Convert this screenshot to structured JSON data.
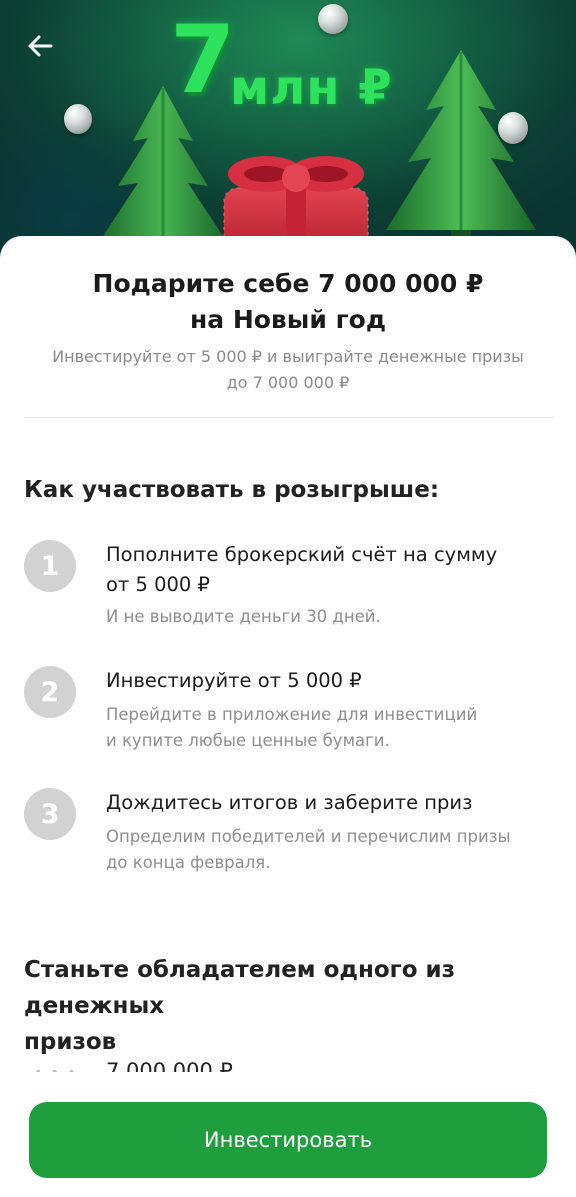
{
  "hero": {
    "title_number": "7",
    "title_suffix": "млн ₽",
    "back_icon": "arrow-left-icon",
    "colors": {
      "hero_green": "#2ee25e",
      "hero_bg": "#0c3e33",
      "gift_red": "#d2283a",
      "tree_green": "#3aa24a"
    }
  },
  "main": {
    "headline_line1": "Подарите себе 7 000 000 ₽",
    "headline_line2": "на Новый год",
    "subline_line1": "Инвестируйте от 5 000 ₽ и выиграйте денежные призы",
    "subline_line2": "до 7 000 000 ₽"
  },
  "how_to": {
    "title": "Как участвовать в розыгрыше:",
    "steps": [
      {
        "number": "1",
        "title_line1": "Пополните брокерский счёт на сумму",
        "title_line2": "от 5 000 ₽",
        "desc_line1": "И не выводите деньги 30 дней.",
        "desc_line2": ""
      },
      {
        "number": "2",
        "title_line1": "Инвестируйте от 5 000 ₽",
        "title_line2": "",
        "desc_line1": "Перейдите в приложение для инвестиций",
        "desc_line2": "и купите любые ценные бумаги."
      },
      {
        "number": "3",
        "title_line1": "Дождитесь итогов и заберите приз",
        "title_line2": "",
        "desc_line1": "Определим победителей и перечислим призы",
        "desc_line2": "до конца февраля."
      }
    ]
  },
  "prizes": {
    "title_line1": "Станьте обладателем одного из денежных",
    "title_line2": "призов",
    "first_amount": "7 000 000 ₽"
  },
  "cta": {
    "label": "Инвестировать",
    "color": "#1f9e3e"
  }
}
